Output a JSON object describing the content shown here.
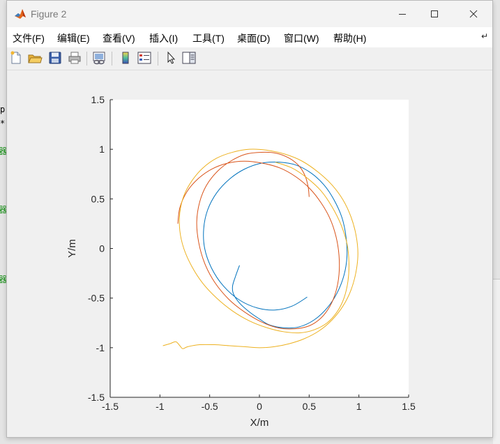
{
  "window": {
    "title": "Figure 2"
  },
  "menu": {
    "items": [
      {
        "label": "文件(F)"
      },
      {
        "label": "编辑(E)"
      },
      {
        "label": "查看(V)"
      },
      {
        "label": "插入(I)"
      },
      {
        "label": "工具(T)"
      },
      {
        "label": "桌面(D)"
      },
      {
        "label": "窗口(W)"
      },
      {
        "label": "帮助(H)"
      }
    ]
  },
  "background_code": {
    "fragments": [
      "p",
      "*",
      "器",
      "器",
      "器"
    ],
    "color": "#0a8a0a"
  },
  "toolbar": {
    "icons": [
      "new-figure-icon",
      "open-file-icon",
      "save-icon",
      "print-icon",
      "link-plot-icon",
      "insert-colorbar-icon",
      "insert-legend-icon",
      "edit-plot-pointer-icon",
      "property-inspector-icon"
    ]
  },
  "chart_data": {
    "type": "line",
    "title": "",
    "xlabel": "X/m",
    "ylabel": "Y/m",
    "xlim": [
      -1.5,
      1.5
    ],
    "ylim": [
      -1.5,
      1.5
    ],
    "xticks": [
      -1.5,
      -1,
      -0.5,
      0,
      0.5,
      1,
      1.5
    ],
    "yticks": [
      -1.5,
      -1,
      -0.5,
      0,
      0.5,
      1,
      1.5
    ],
    "xtick_labels": [
      "-1.5",
      "-1",
      "-0.5",
      "0",
      "0.5",
      "1",
      "1.5"
    ],
    "ytick_labels": [
      "-1.5",
      "-1",
      "-0.5",
      "0",
      "0.5",
      "1",
      "1.5"
    ],
    "grid": false,
    "legend": "none",
    "axis_color": "#262626",
    "series": [
      {
        "color": "#0072bd",
        "x": [
          -0.2,
          -0.24,
          -0.27,
          -0.26,
          -0.2,
          -0.1,
          0.0,
          0.1,
          0.25,
          0.4,
          0.55,
          0.68,
          0.78,
          0.85,
          0.88,
          0.87,
          0.83,
          0.75,
          0.65,
          0.52,
          0.37,
          0.2,
          0.02,
          -0.15,
          -0.3,
          -0.43,
          -0.52,
          -0.56,
          -0.55,
          -0.48,
          -0.36,
          -0.2,
          -0.02,
          0.16,
          0.33,
          0.48
        ],
        "y": [
          -0.17,
          -0.28,
          -0.38,
          -0.46,
          -0.55,
          -0.64,
          -0.71,
          -0.77,
          -0.8,
          -0.79,
          -0.72,
          -0.6,
          -0.45,
          -0.27,
          -0.08,
          0.12,
          0.31,
          0.49,
          0.64,
          0.76,
          0.84,
          0.87,
          0.86,
          0.8,
          0.7,
          0.56,
          0.39,
          0.2,
          0.0,
          -0.2,
          -0.38,
          -0.52,
          -0.6,
          -0.62,
          -0.58,
          -0.49
        ]
      },
      {
        "color": "#d95319",
        "x": [
          0.5,
          0.49,
          0.46,
          0.4,
          0.3,
          0.17,
          0.02,
          -0.14,
          -0.29,
          -0.42,
          -0.53,
          -0.6,
          -0.63,
          -0.61,
          -0.55,
          -0.45,
          -0.31,
          -0.15,
          0.02,
          0.19,
          0.35,
          0.5,
          0.62,
          0.71,
          0.77,
          0.8,
          0.8,
          0.77,
          0.71,
          0.62,
          0.51,
          0.37,
          0.21,
          0.03,
          -0.15,
          -0.32,
          -0.48,
          -0.62,
          -0.73,
          -0.8,
          -0.82
        ],
        "y": [
          0.52,
          0.62,
          0.73,
          0.83,
          0.91,
          0.96,
          0.97,
          0.95,
          0.88,
          0.78,
          0.64,
          0.47,
          0.27,
          0.06,
          -0.15,
          -0.34,
          -0.51,
          -0.64,
          -0.74,
          -0.8,
          -0.81,
          -0.78,
          -0.7,
          -0.58,
          -0.43,
          -0.26,
          -0.07,
          0.12,
          0.3,
          0.46,
          0.6,
          0.72,
          0.81,
          0.86,
          0.88,
          0.86,
          0.8,
          0.7,
          0.57,
          0.41,
          0.25
        ]
      },
      {
        "color": "#edb120",
        "x": [
          -0.97,
          -0.9,
          -0.84,
          -0.8,
          -0.77,
          -0.72,
          -0.6,
          -0.45,
          -0.3,
          -0.15,
          0.0,
          0.15,
          0.3,
          0.45,
          0.6,
          0.73,
          0.84,
          0.92,
          0.97,
          0.99,
          0.97,
          0.92,
          0.84,
          0.73,
          0.59,
          0.43,
          0.26,
          0.08,
          -0.1,
          -0.27,
          -0.43,
          -0.57,
          -0.68,
          -0.76,
          -0.8,
          -0.8,
          -0.76,
          -0.68,
          -0.57,
          -0.43,
          -0.27,
          -0.1,
          0.08,
          0.25,
          0.41,
          0.55,
          0.68,
          0.78,
          0.85,
          0.89,
          0.9,
          0.88,
          0.82,
          0.73,
          0.62,
          0.48,
          0.33,
          0.16
        ],
        "y": [
          -0.98,
          -0.96,
          -0.94,
          -0.98,
          -1.01,
          -0.99,
          -0.97,
          -0.97,
          -0.98,
          -0.99,
          -1.0,
          -0.99,
          -0.96,
          -0.91,
          -0.83,
          -0.72,
          -0.58,
          -0.42,
          -0.24,
          -0.05,
          0.14,
          0.32,
          0.49,
          0.64,
          0.77,
          0.88,
          0.95,
          0.99,
          1.0,
          0.97,
          0.91,
          0.81,
          0.68,
          0.53,
          0.36,
          0.18,
          0.0,
          -0.18,
          -0.35,
          -0.5,
          -0.63,
          -0.73,
          -0.8,
          -0.84,
          -0.85,
          -0.82,
          -0.75,
          -0.64,
          -0.5,
          -0.33,
          -0.14,
          0.05,
          0.24,
          0.42,
          0.58,
          0.71,
          0.81,
          0.87
        ]
      }
    ]
  }
}
